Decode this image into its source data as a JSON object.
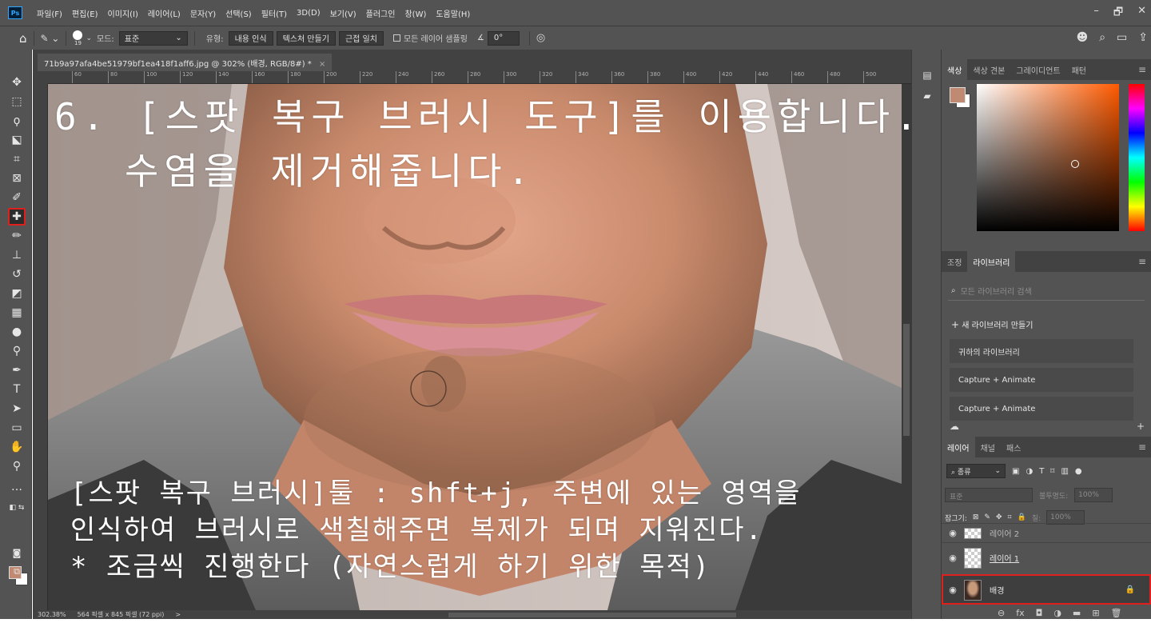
{
  "app": {
    "logo": "Ps"
  },
  "menu": [
    "파일(F)",
    "편집(E)",
    "이미지(I)",
    "레이어(L)",
    "문자(Y)",
    "선택(S)",
    "필터(T)",
    "3D(D)",
    "보기(V)",
    "플러그인",
    "창(W)",
    "도움말(H)"
  ],
  "window_controls": [
    "–",
    "🗗",
    "✕"
  ],
  "options": {
    "brush_size": "19",
    "mode_label": "모드:",
    "mode_value": "표준",
    "type_label": "유형:",
    "type_buttons": [
      "내용 인식",
      "텍스처 만들기",
      "근접 일치"
    ],
    "sample_all_label": "모든 레이어 샘플링",
    "angle_value": "0°"
  },
  "document": {
    "tab_title": "71b9a97afa4be51979bf1ea418f1aff6.jpg @ 302% (배경, RGB/8#) *",
    "close": "×",
    "zoom": "302.38%",
    "size_info": "564 픽셀 x 845 픽셀 (72 ppi)",
    "status_arrow": ">"
  },
  "ruler_ticks": [
    "60",
    "80",
    "100",
    "120",
    "140",
    "160",
    "180",
    "200",
    "220",
    "240",
    "260",
    "280",
    "300",
    "320",
    "340",
    "360",
    "380",
    "400",
    "420",
    "440",
    "460",
    "480",
    "500"
  ],
  "overlay": {
    "title_line1": "6. [스팟 복구 브러시 도구]를 이용합니다.",
    "title_line2": "수염을 제거해줍니다.",
    "body_line1": "[스팟 복구 브러시]툴 : shft+j, 주변에 있는 영역을",
    "body_line2": "인식하여 브러시로 색칠해주면 복제가 되며 지워진다.",
    "body_line3": "* 조금씩 진행한다 (자연스럽게 하기 위한 목적)"
  },
  "colors": {
    "foreground": "#c08a72",
    "background": "#ffffff",
    "highlight_red": "#e0201e"
  },
  "panels": {
    "color_tabs": [
      "색상",
      "색상 견본",
      "그레이디언트",
      "패턴"
    ],
    "library_tabs": [
      "조정",
      "라이브러리"
    ],
    "library_search_placeholder": "모든 라이브러리 검색",
    "new_library": "새 라이브러리 만들기",
    "libraries": [
      "귀하의 라이브러리",
      "Capture + Animate",
      "Capture + Animate"
    ],
    "layers_tabs": [
      "레이어",
      "채널",
      "패스"
    ],
    "layers_kind": "종류",
    "blend_mode": "표준",
    "opacity_label": "불투명도:",
    "opacity_value": "100%",
    "lock_label": "잠그기:",
    "fill_label": "칠:",
    "fill_value": "100%",
    "layers": [
      {
        "name": "레이어 2"
      },
      {
        "name": "레이어 1"
      },
      {
        "name": "배경"
      }
    ]
  }
}
